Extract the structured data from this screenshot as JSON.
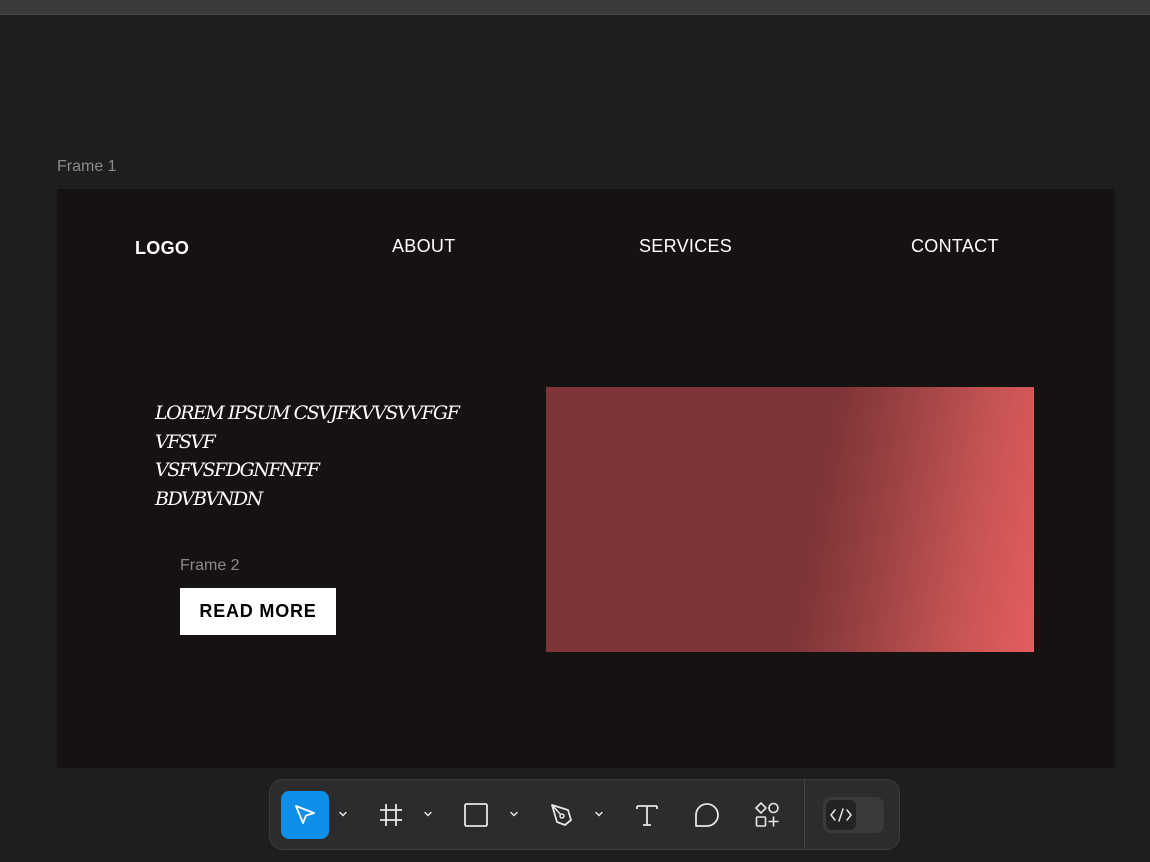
{
  "canvas": {
    "frame1_label": "Frame 1",
    "frame2_label": "Frame 2"
  },
  "site": {
    "logo": "LOGO",
    "nav": {
      "about": "ABOUT",
      "services": "SERVICES",
      "contact": "CONTACT"
    },
    "hero_text": "LOREM IPSUM CSVJFKVVSVVFGF\nVFSVF\nVSFVSFDGNFNFF\nBDVBVNDN",
    "read_more_label": "READ MORE",
    "gradient_colors": [
      "#7f3437",
      "#e45d5e"
    ]
  },
  "toolbar": {
    "tools": [
      {
        "name": "move",
        "icon": "cursor-arrow-icon",
        "active": true
      },
      {
        "name": "frame",
        "icon": "frame-hash-icon"
      },
      {
        "name": "rectangle",
        "icon": "rectangle-icon"
      },
      {
        "name": "pen",
        "icon": "pen-icon"
      },
      {
        "name": "text",
        "icon": "text-t-icon"
      },
      {
        "name": "comment",
        "icon": "comment-bubble-icon"
      },
      {
        "name": "assets",
        "icon": "shapes-plus-icon"
      }
    ],
    "dev_mode_icon": "code-brackets-icon",
    "accent_color": "#0d8ee9"
  }
}
